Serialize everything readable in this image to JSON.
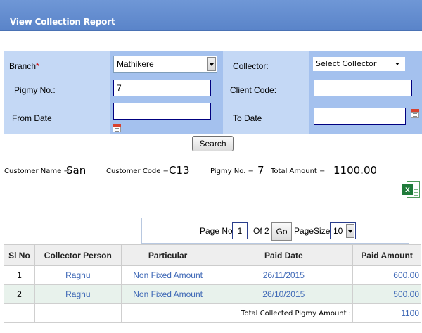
{
  "header": {
    "title": "View Collection Report"
  },
  "form": {
    "branch_label": "Branch",
    "required_mark": "*",
    "branch_value": "Mathikere",
    "collector_label": "Collector:",
    "collector_value": "Select Collector",
    "pigmy_label": "Pigmy No.:",
    "pigmy_value": "7",
    "client_code_label": "Client Code:",
    "client_code_value": "",
    "from_date_label": "From Date",
    "from_date_value": "",
    "to_date_label": "To Date",
    "to_date_value": "",
    "search_label": "Search"
  },
  "summary": {
    "customer_name_label": "Customer Name =",
    "customer_name": "San",
    "customer_code_label": "Customer Code =",
    "customer_code": "C13",
    "pigmy_no_label": "Pigmy No. =",
    "pigmy_no": "7",
    "total_amount_label": "Total Amount =",
    "total_amount": "1100.00"
  },
  "pager": {
    "page_no_label": "Page No:",
    "page_no": "1",
    "of_label": "Of 2",
    "go_label": "Go",
    "page_size_label": "PageSize:",
    "page_size": "10"
  },
  "table": {
    "headers": [
      "Sl No",
      "Collector Person",
      "Particular",
      "Paid Date",
      "Paid Amount"
    ],
    "rows": [
      {
        "sl": "1",
        "collector": "Raghu",
        "particular": "Non Fixed Amount",
        "date": "26/11/2015",
        "amount": "600.00"
      },
      {
        "sl": "2",
        "collector": "Raghu",
        "particular": "Non Fixed Amount",
        "date": "26/10/2015",
        "amount": "500.00"
      }
    ],
    "total_label": "Total Collected Pigmy Amount :",
    "total_value": "1100"
  },
  "colors": {
    "header_bg": "#5a84c9",
    "label_cell": "#c4d8f5",
    "field_cell": "#a4c1ee",
    "link": "#3e68b6",
    "alt_row": "#e8f2ec"
  },
  "icons": [
    "calendar-icon",
    "excel-icon",
    "chevron-down-icon"
  ]
}
